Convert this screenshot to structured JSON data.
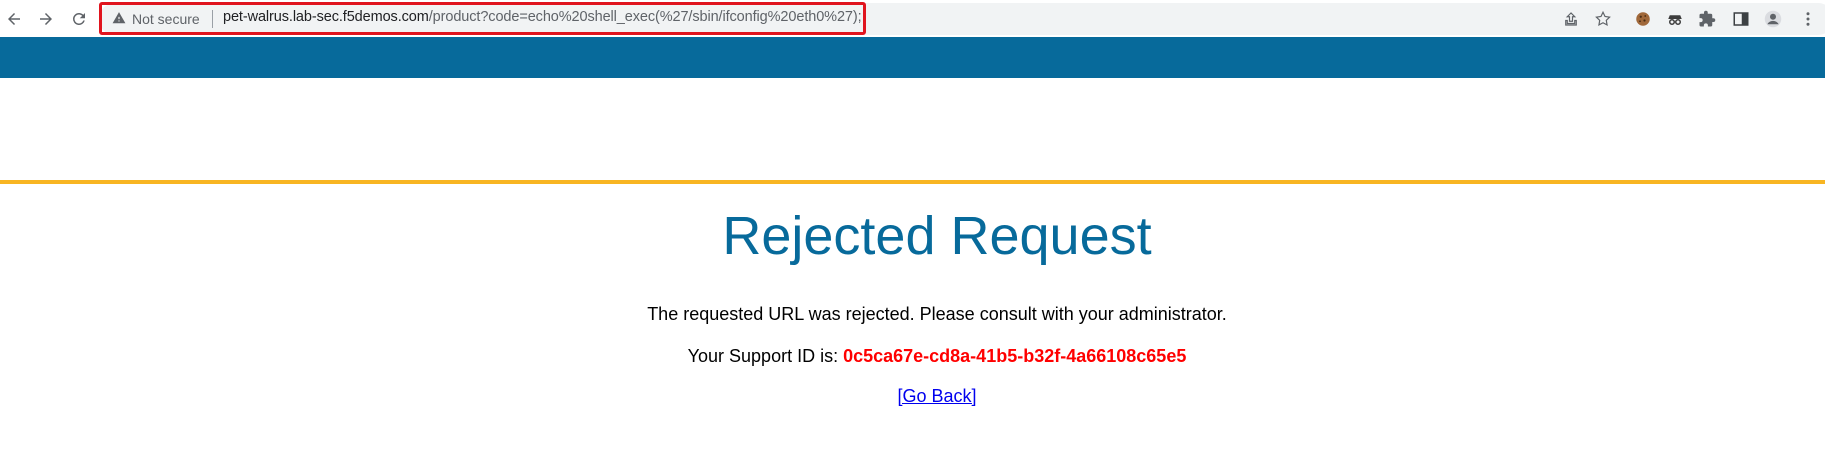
{
  "browser": {
    "security_label": "Not secure",
    "url_host": "pet-walrus.lab-sec.f5demos.com",
    "url_path": "/product?code=echo%20shell_exec(%27/sbin/ifconfig%20eth0%27);",
    "icons": [
      "back-icon",
      "forward-icon",
      "reload-icon",
      "warning-icon",
      "share-icon",
      "star-icon",
      "cookie-extension-icon",
      "spy-extension-icon",
      "extensions-puzzle-icon",
      "side-panel-icon",
      "profile-icon",
      "menu-icon"
    ],
    "highlight_color": "#e0141e"
  },
  "page": {
    "title": "Rejected Request",
    "message": "The requested URL was rejected. Please consult with your administrator.",
    "support_prefix": "Your Support ID is: ",
    "support_id": "0c5ca67e-cd8a-41b5-b32f-4a66108c65e5",
    "go_back": "[Go Back]",
    "colors": {
      "header_bar": "#076a9b",
      "accent_rule": "#f8b522",
      "title": "#076a9b",
      "support_id": "#ff0000",
      "link": "#0000ee"
    }
  }
}
